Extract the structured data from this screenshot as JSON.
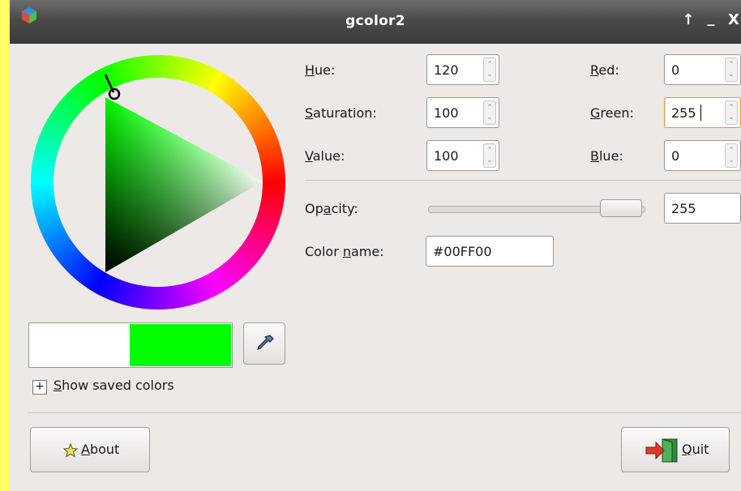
{
  "window": {
    "title": "gcolor2",
    "controls": {
      "restore": "↑",
      "minimize": "_",
      "close": "X"
    }
  },
  "hsv": {
    "hue": {
      "label": "Hue:",
      "mnemonic": "H",
      "rest": "ue:",
      "value": "120"
    },
    "saturation": {
      "label": "Saturation:",
      "mnemonic": "S",
      "rest": "aturation:",
      "value": "100"
    },
    "value": {
      "label": "Value:",
      "mnemonic": "V",
      "rest": "alue:",
      "value": "100"
    }
  },
  "rgb": {
    "red": {
      "label": "Red:",
      "mnemonic": "R",
      "rest": "ed:",
      "value": "0"
    },
    "green": {
      "label": "Green:",
      "mnemonic": "G",
      "rest": "reen:",
      "value": "255"
    },
    "blue": {
      "label": "Blue:",
      "mnemonic": "B",
      "rest": "lue:",
      "value": "0"
    }
  },
  "opacity": {
    "label": "Opacity:",
    "pre": "Op",
    "mnemonic": "a",
    "rest": "city:",
    "value": "255",
    "slider_fraction": 1.0
  },
  "color_name": {
    "label": "Color name:",
    "pre": "Color ",
    "mnemonic": "n",
    "rest": "ame:",
    "value": "#00FF00"
  },
  "swatch": {
    "previous_color": "#ffffff",
    "current_color": "#00ff00"
  },
  "saved_colors": {
    "label": "Show saved colors",
    "mnemonic": "S",
    "rest": "how saved colors",
    "expander": "+"
  },
  "buttons": {
    "about": {
      "label": "About",
      "mnemonic": "A",
      "rest": "bout",
      "icon": "star-icon"
    },
    "quit": {
      "label": "Quit",
      "mnemonic": "Q",
      "rest": "uit",
      "icon": "exit-door-icon"
    },
    "eyedropper": {
      "icon": "eyedropper-icon"
    }
  },
  "colors": {
    "titlebar": "#4a4a4a",
    "window_bg": "#ede9e7",
    "desktop": "#ffff66",
    "focus": "#e8923a"
  }
}
